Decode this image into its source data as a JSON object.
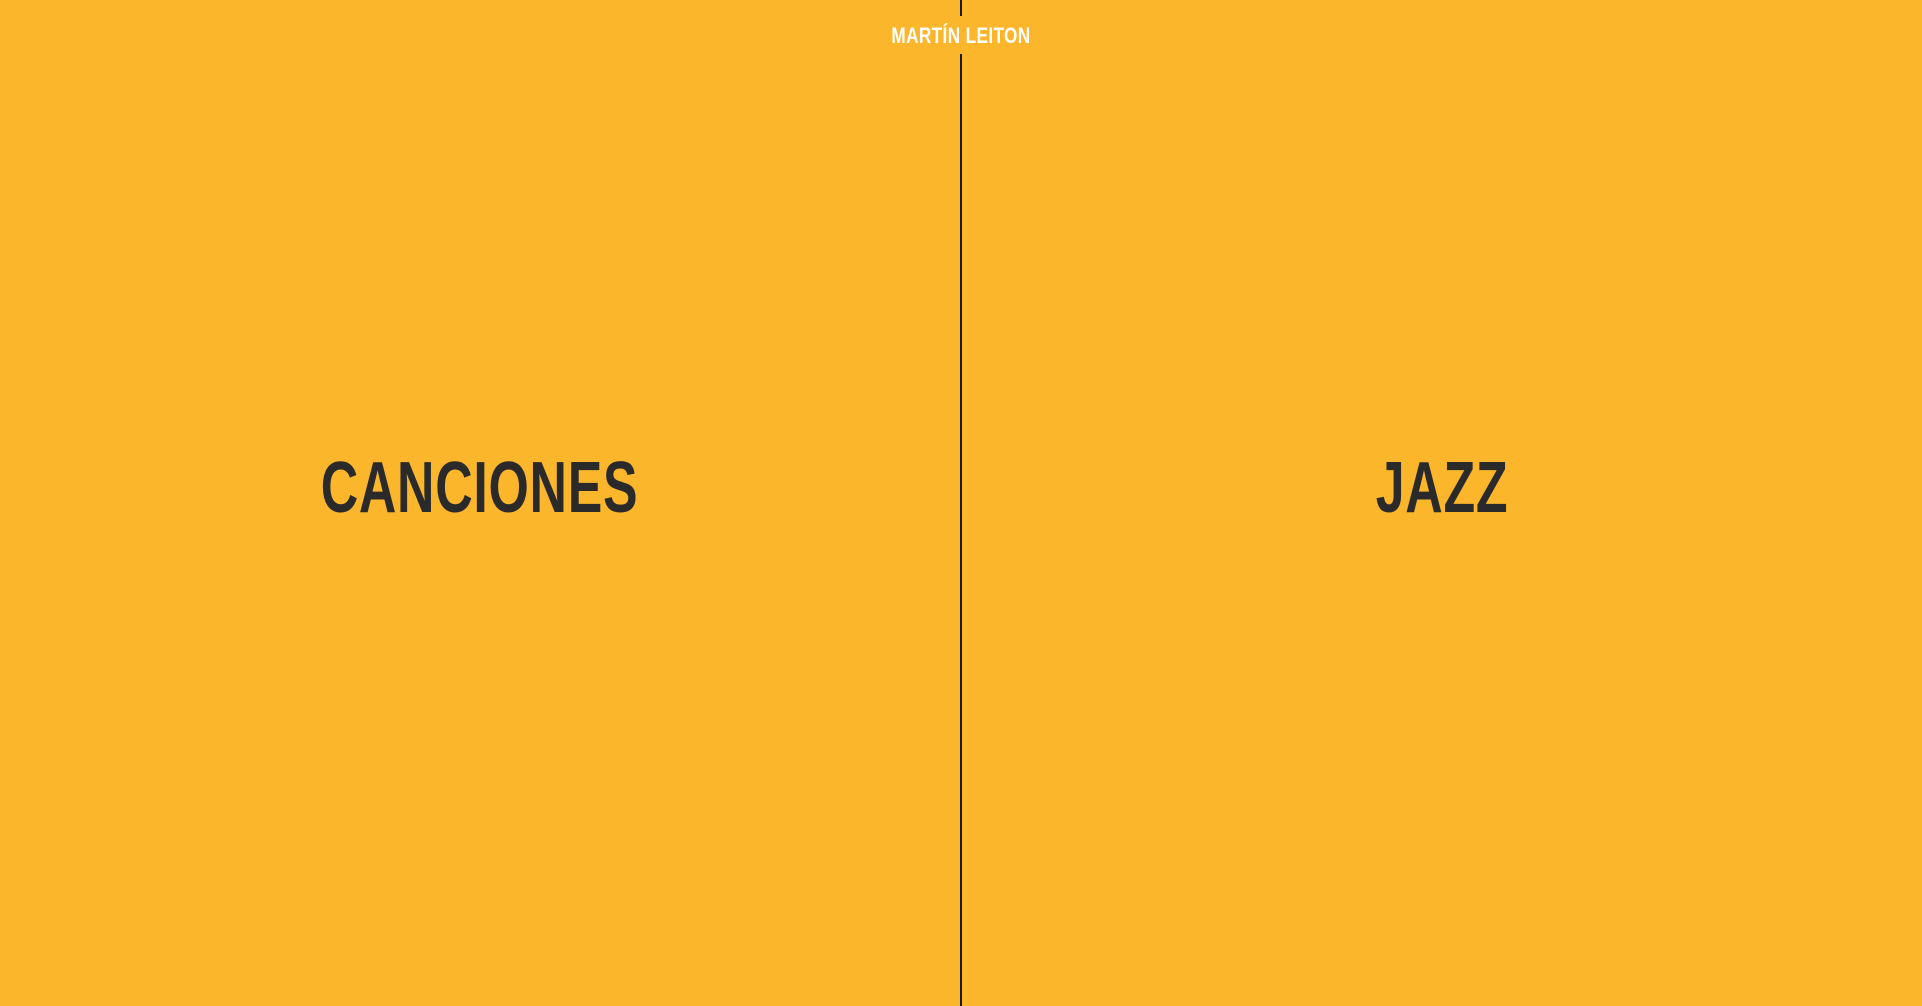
{
  "header": {
    "site_title": "MARTÍN LEITON"
  },
  "panels": [
    {
      "label": "CANCIONES"
    },
    {
      "label": "JAZZ"
    }
  ],
  "colors": {
    "background": "#FCB62C",
    "title_text": "#FFFFFF",
    "label_text": "#2A2A2A",
    "divider": "#1A1A1A"
  }
}
